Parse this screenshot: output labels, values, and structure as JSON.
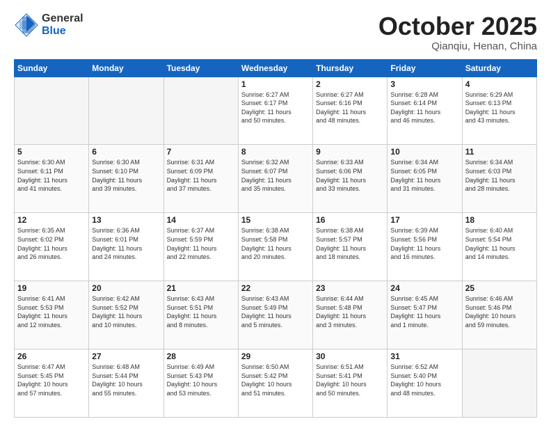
{
  "header": {
    "logo_general": "General",
    "logo_blue": "Blue",
    "month": "October 2025",
    "location": "Qianqiu, Henan, China"
  },
  "weekdays": [
    "Sunday",
    "Monday",
    "Tuesday",
    "Wednesday",
    "Thursday",
    "Friday",
    "Saturday"
  ],
  "weeks": [
    [
      {
        "day": "",
        "info": ""
      },
      {
        "day": "",
        "info": ""
      },
      {
        "day": "",
        "info": ""
      },
      {
        "day": "1",
        "info": "Sunrise: 6:27 AM\nSunset: 6:17 PM\nDaylight: 11 hours\nand 50 minutes."
      },
      {
        "day": "2",
        "info": "Sunrise: 6:27 AM\nSunset: 6:16 PM\nDaylight: 11 hours\nand 48 minutes."
      },
      {
        "day": "3",
        "info": "Sunrise: 6:28 AM\nSunset: 6:14 PM\nDaylight: 11 hours\nand 46 minutes."
      },
      {
        "day": "4",
        "info": "Sunrise: 6:29 AM\nSunset: 6:13 PM\nDaylight: 11 hours\nand 43 minutes."
      }
    ],
    [
      {
        "day": "5",
        "info": "Sunrise: 6:30 AM\nSunset: 6:11 PM\nDaylight: 11 hours\nand 41 minutes."
      },
      {
        "day": "6",
        "info": "Sunrise: 6:30 AM\nSunset: 6:10 PM\nDaylight: 11 hours\nand 39 minutes."
      },
      {
        "day": "7",
        "info": "Sunrise: 6:31 AM\nSunset: 6:09 PM\nDaylight: 11 hours\nand 37 minutes."
      },
      {
        "day": "8",
        "info": "Sunrise: 6:32 AM\nSunset: 6:07 PM\nDaylight: 11 hours\nand 35 minutes."
      },
      {
        "day": "9",
        "info": "Sunrise: 6:33 AM\nSunset: 6:06 PM\nDaylight: 11 hours\nand 33 minutes."
      },
      {
        "day": "10",
        "info": "Sunrise: 6:34 AM\nSunset: 6:05 PM\nDaylight: 11 hours\nand 31 minutes."
      },
      {
        "day": "11",
        "info": "Sunrise: 6:34 AM\nSunset: 6:03 PM\nDaylight: 11 hours\nand 28 minutes."
      }
    ],
    [
      {
        "day": "12",
        "info": "Sunrise: 6:35 AM\nSunset: 6:02 PM\nDaylight: 11 hours\nand 26 minutes."
      },
      {
        "day": "13",
        "info": "Sunrise: 6:36 AM\nSunset: 6:01 PM\nDaylight: 11 hours\nand 24 minutes."
      },
      {
        "day": "14",
        "info": "Sunrise: 6:37 AM\nSunset: 5:59 PM\nDaylight: 11 hours\nand 22 minutes."
      },
      {
        "day": "15",
        "info": "Sunrise: 6:38 AM\nSunset: 5:58 PM\nDaylight: 11 hours\nand 20 minutes."
      },
      {
        "day": "16",
        "info": "Sunrise: 6:38 AM\nSunset: 5:57 PM\nDaylight: 11 hours\nand 18 minutes."
      },
      {
        "day": "17",
        "info": "Sunrise: 6:39 AM\nSunset: 5:56 PM\nDaylight: 11 hours\nand 16 minutes."
      },
      {
        "day": "18",
        "info": "Sunrise: 6:40 AM\nSunset: 5:54 PM\nDaylight: 11 hours\nand 14 minutes."
      }
    ],
    [
      {
        "day": "19",
        "info": "Sunrise: 6:41 AM\nSunset: 5:53 PM\nDaylight: 11 hours\nand 12 minutes."
      },
      {
        "day": "20",
        "info": "Sunrise: 6:42 AM\nSunset: 5:52 PM\nDaylight: 11 hours\nand 10 minutes."
      },
      {
        "day": "21",
        "info": "Sunrise: 6:43 AM\nSunset: 5:51 PM\nDaylight: 11 hours\nand 8 minutes."
      },
      {
        "day": "22",
        "info": "Sunrise: 6:43 AM\nSunset: 5:49 PM\nDaylight: 11 hours\nand 5 minutes."
      },
      {
        "day": "23",
        "info": "Sunrise: 6:44 AM\nSunset: 5:48 PM\nDaylight: 11 hours\nand 3 minutes."
      },
      {
        "day": "24",
        "info": "Sunrise: 6:45 AM\nSunset: 5:47 PM\nDaylight: 11 hours\nand 1 minute."
      },
      {
        "day": "25",
        "info": "Sunrise: 6:46 AM\nSunset: 5:46 PM\nDaylight: 10 hours\nand 59 minutes."
      }
    ],
    [
      {
        "day": "26",
        "info": "Sunrise: 6:47 AM\nSunset: 5:45 PM\nDaylight: 10 hours\nand 57 minutes."
      },
      {
        "day": "27",
        "info": "Sunrise: 6:48 AM\nSunset: 5:44 PM\nDaylight: 10 hours\nand 55 minutes."
      },
      {
        "day": "28",
        "info": "Sunrise: 6:49 AM\nSunset: 5:43 PM\nDaylight: 10 hours\nand 53 minutes."
      },
      {
        "day": "29",
        "info": "Sunrise: 6:50 AM\nSunset: 5:42 PM\nDaylight: 10 hours\nand 51 minutes."
      },
      {
        "day": "30",
        "info": "Sunrise: 6:51 AM\nSunset: 5:41 PM\nDaylight: 10 hours\nand 50 minutes."
      },
      {
        "day": "31",
        "info": "Sunrise: 6:52 AM\nSunset: 5:40 PM\nDaylight: 10 hours\nand 48 minutes."
      },
      {
        "day": "",
        "info": ""
      }
    ]
  ]
}
